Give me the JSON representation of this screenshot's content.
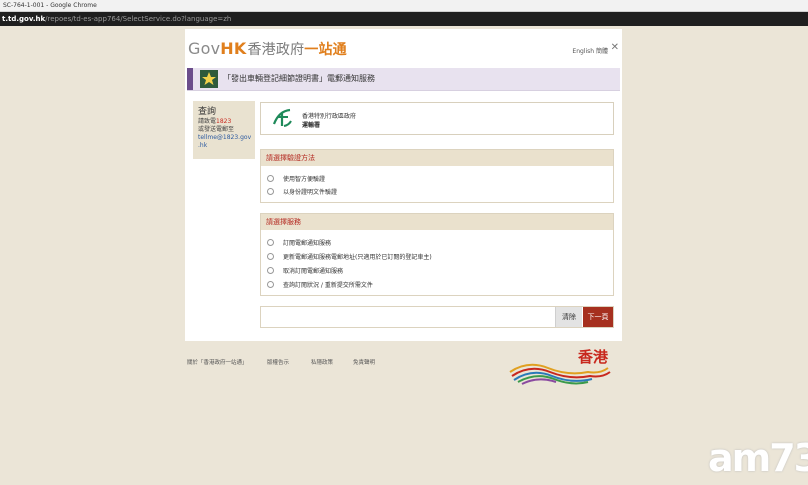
{
  "browser": {
    "window_title": "SC-764-1-001 - Google Chrome",
    "url_host": "t.td.gov.hk",
    "url_path": "/repoes/td-es-app764/SelectService.do?language=zh"
  },
  "header": {
    "logo_gov": "Gov",
    "logo_hk": "HK",
    "logo_zh_a": "香港政府",
    "logo_zh_b": "一站通",
    "lang_link": "English 簡體",
    "close_label": "✕"
  },
  "service": {
    "title": "「發出車輛登記細節證明書」電郵通知服務"
  },
  "sidebar": {
    "heading": "查詢",
    "line1_prefix": "請致電",
    "line1_phone": "1823",
    "line2": "或發送電郵至",
    "email_a": "tellme@1823.gov",
    "email_b": ".hk"
  },
  "agency": {
    "gov_name": "香港特別行政區政府",
    "dept_name": "運輸署"
  },
  "verify": {
    "heading": "請選擇驗證方法",
    "options": [
      "使用智方便驗證",
      "以身份證明文件驗證"
    ]
  },
  "services": {
    "heading": "請選擇服務",
    "options": [
      "訂閱電郵通知服務",
      "更新電郵通知服務電郵地址(只適用於已訂閱的登記車主)",
      "取消訂閱電郵通知服務",
      "查詢訂閱狀況 / 重新提交所需文件"
    ]
  },
  "actions": {
    "clear_label": "清除",
    "next_label": "下一頁"
  },
  "footer": {
    "links": [
      "關於「香港政府一站通」",
      "版權告示",
      "私隱政策",
      "免責聲明"
    ],
    "brand_zh": "香港"
  },
  "watermark": {
    "text": "am73"
  },
  "colors": {
    "accent_orange": "#e07f1d",
    "purple": "#6b4d8b",
    "red": "#a6301f",
    "panel": "#eae1cd"
  }
}
